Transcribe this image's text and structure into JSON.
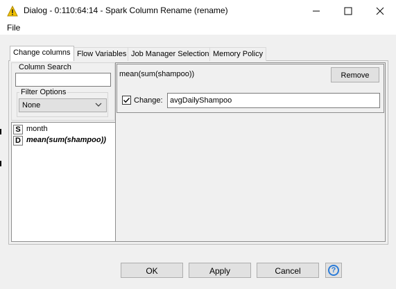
{
  "window": {
    "title": "Dialog - 0:110:64:14 - Spark Column Rename (rename)",
    "app_icon": "warning-triangle-icon",
    "minimize_icon": "minimize-icon",
    "maximize_icon": "maximize-icon",
    "close_icon": "close-icon"
  },
  "menu": {
    "file": "File"
  },
  "tabs": [
    {
      "label": "Change columns",
      "active": true
    },
    {
      "label": "Flow Variables",
      "active": false
    },
    {
      "label": "Job Manager Selection",
      "active": false
    },
    {
      "label": "Memory Policy",
      "active": false
    }
  ],
  "column_search": {
    "label": "Column Search",
    "value": ""
  },
  "filter_options": {
    "label": "Filter Options",
    "selected": "None"
  },
  "columns": [
    {
      "type": "S",
      "name": "month",
      "renamed": false
    },
    {
      "type": "D",
      "name": "mean(sum(shampoo))",
      "renamed": true
    }
  ],
  "rename_panel": {
    "column": "mean(sum(shampoo))",
    "remove_label": "Remove",
    "change_label": "Change:",
    "change_checked": true,
    "new_name": "avgDailyShampoo"
  },
  "buttons": {
    "ok": "OK",
    "apply": "Apply",
    "cancel": "Cancel",
    "help_icon": "help-icon",
    "help_symbol": "?"
  },
  "colors": {
    "accent": "#2a7bd8",
    "warning": "#f2c200"
  }
}
